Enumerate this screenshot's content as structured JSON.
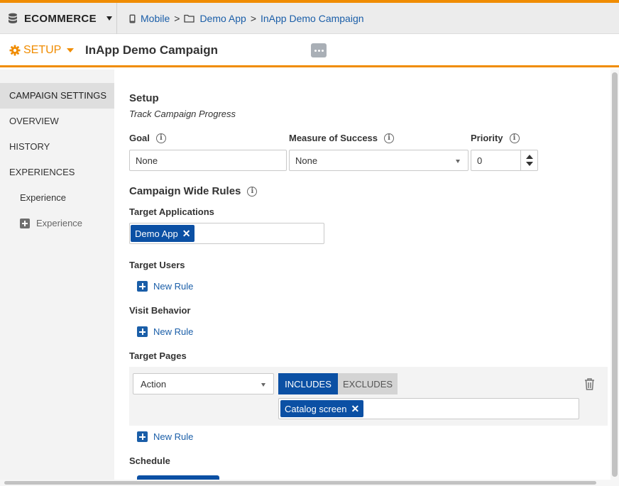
{
  "workspace": {
    "name": "ECOMMERCE"
  },
  "breadcrumb": {
    "items": [
      "Mobile",
      "Demo App",
      "InApp Demo Campaign"
    ],
    "separator": ">"
  },
  "header": {
    "setup_label": "SETUP",
    "title": "InApp Demo Campaign"
  },
  "sidebar": {
    "items": [
      {
        "label": "CAMPAIGN SETTINGS"
      },
      {
        "label": "OVERVIEW"
      },
      {
        "label": "HISTORY"
      },
      {
        "label": "EXPERIENCES"
      },
      {
        "label": "Experience"
      },
      {
        "label": "Experience"
      }
    ]
  },
  "setup": {
    "heading": "Setup",
    "subtitle": "Track Campaign Progress",
    "goal": {
      "label": "Goal",
      "value": "None"
    },
    "measure": {
      "label": "Measure of Success",
      "value": "None"
    },
    "priority": {
      "label": "Priority",
      "value": "0"
    }
  },
  "rules": {
    "heading": "Campaign Wide Rules",
    "target_apps": {
      "label": "Target Applications",
      "tag": "Demo App"
    },
    "target_users": {
      "label": "Target Users",
      "new_rule": "New Rule"
    },
    "visit_behavior": {
      "label": "Visit Behavior",
      "new_rule": "New Rule"
    },
    "target_pages": {
      "label": "Target Pages",
      "type_value": "Action",
      "includes": "INCLUDES",
      "excludes": "EXCLUDES",
      "tag": "Catalog screen",
      "new_rule": "New Rule"
    }
  },
  "schedule": {
    "label": "Schedule"
  },
  "colors": {
    "accent": "#f08c00",
    "primary": "#0b50a4",
    "link": "#1a5ea8"
  }
}
